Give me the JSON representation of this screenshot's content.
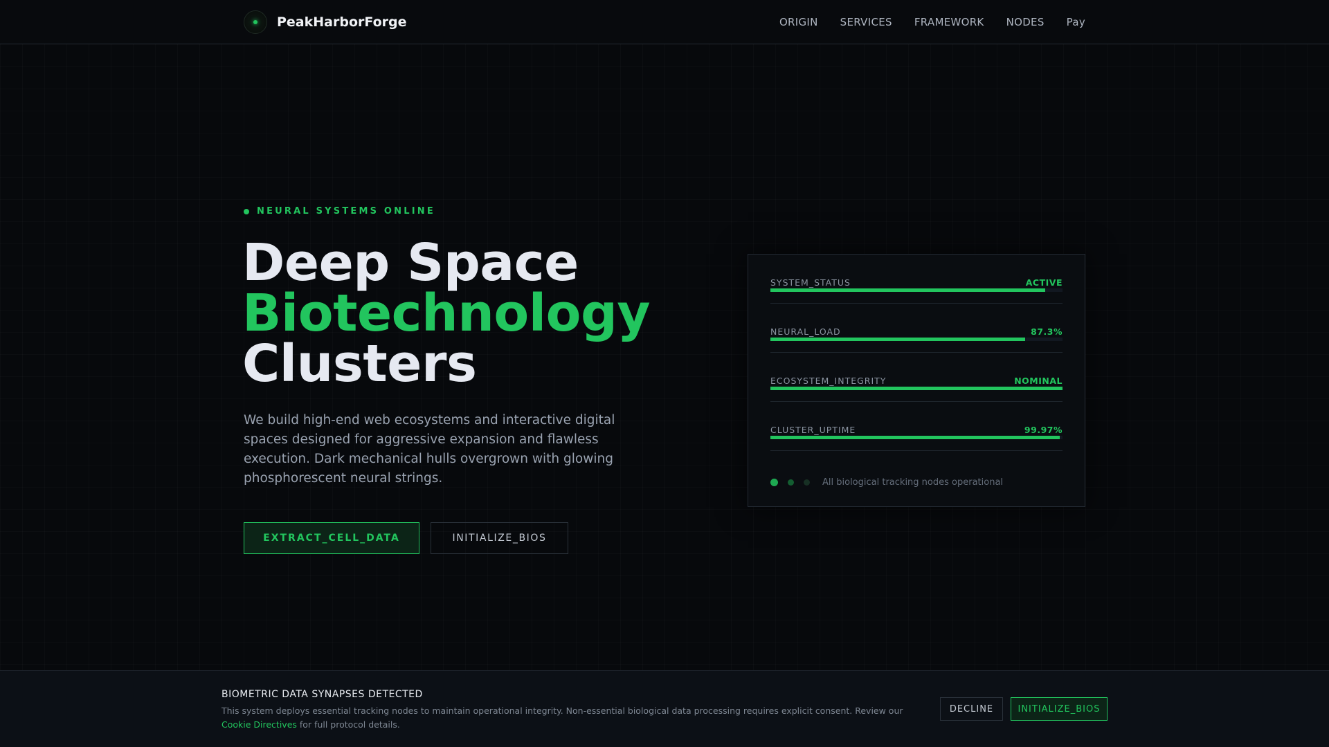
{
  "colors": {
    "accent": "#22c55e",
    "background": "#07090c",
    "panel": "#0a0d11"
  },
  "header": {
    "brand": "PeakHarborForge",
    "nav": [
      "ORIGIN",
      "SERVICES",
      "FRAMEWORK",
      "NODES",
      "Pay"
    ]
  },
  "hero": {
    "status": "NEURAL SYSTEMS ONLINE",
    "title_line1": "Deep Space",
    "title_line2": "Biotechnology",
    "title_line3": "Clusters",
    "description": "We build high-end web ecosystems and interactive digital spaces designed for aggressive expansion and flawless execution. Dark mechanical hulls overgrown with glowing phosphorescent neural strings.",
    "primary_button": "EXTRACT_CELL_DATA",
    "secondary_button": "INITIALIZE_BIOS"
  },
  "panel": {
    "metrics": [
      {
        "label": "SYSTEM_STATUS",
        "value": "ACTIVE",
        "fill": 0.94
      },
      {
        "label": "NEURAL_LOAD",
        "value": "87.3%",
        "fill": 0.873
      },
      {
        "label": "ECOSYSTEM_INTEGRITY",
        "value": "NOMINAL",
        "fill": 1.0
      },
      {
        "label": "CLUSTER_UPTIME",
        "value": "99.97%",
        "fill": 0.99
      }
    ],
    "footer_text": "All biological tracking nodes operational"
  },
  "cookie": {
    "title": "BIOMETRIC DATA SYNAPSES DETECTED",
    "text_before": "This system deploys essential tracking nodes to maintain operational integrity. Non-essential biological data processing requires explicit consent. Review our ",
    "link": "Cookie Directives",
    "text_after": " for full protocol details.",
    "decline": "DECLINE",
    "accept": "INITIALIZE_BIOS"
  }
}
